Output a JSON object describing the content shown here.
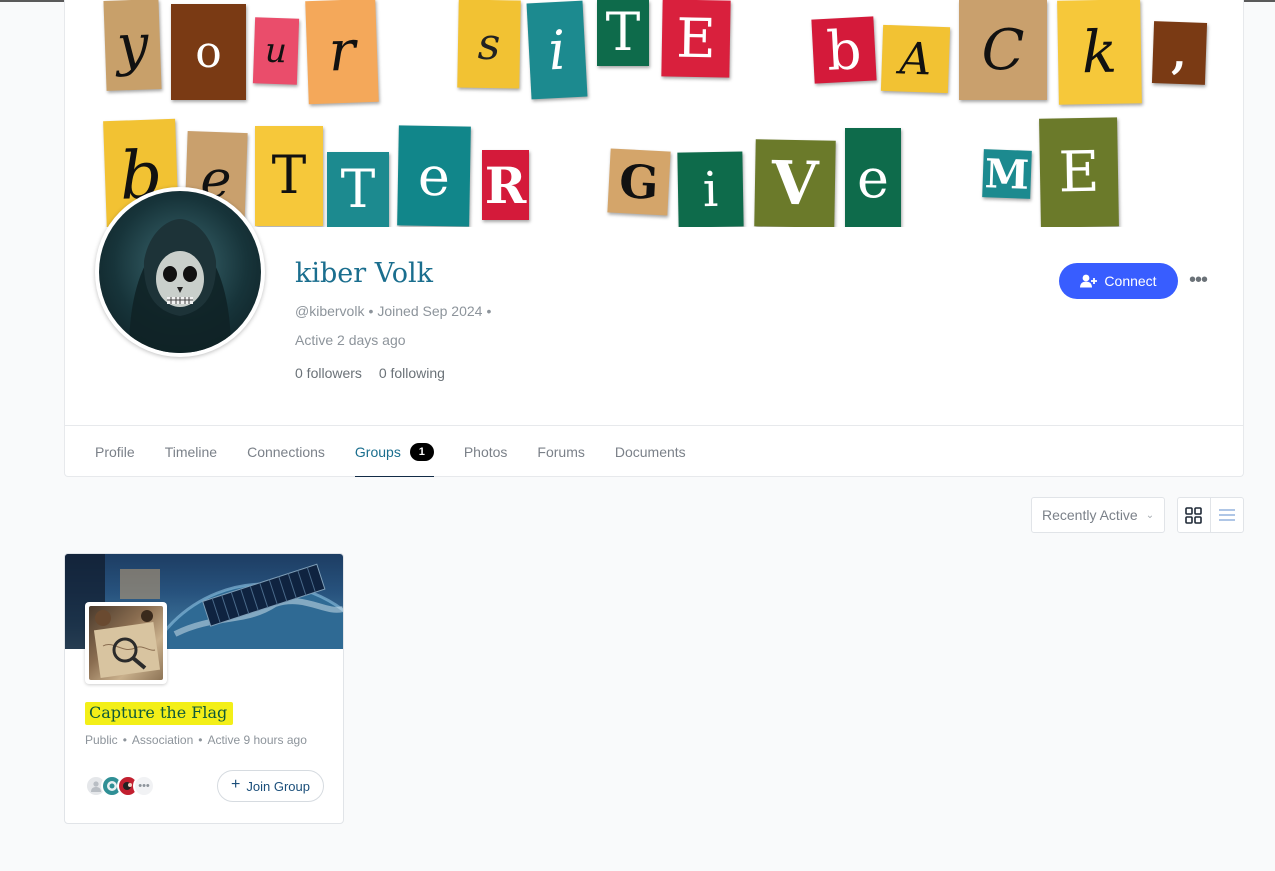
{
  "cover": {
    "letters": [
      {
        "ch": "y",
        "bg": "#c8a06a",
        "fg": "#111111"
      },
      {
        "ch": "o",
        "bg": "#7a3a14",
        "fg": "#ffffff"
      },
      {
        "ch": "u",
        "bg": "#ea4d6b",
        "fg": "#111111"
      },
      {
        "ch": "r",
        "bg": "#f4a85a",
        "fg": "#111111"
      },
      {
        "ch": "s",
        "bg": "#f2c233",
        "fg": "#222222"
      },
      {
        "ch": "i",
        "bg": "#1c8a8f",
        "fg": "#ffffff"
      },
      {
        "ch": "T",
        "bg": "#0e6b4b",
        "fg": "#ffffff"
      },
      {
        "ch": "E",
        "bg": "#d9203d",
        "fg": "#ffffff"
      },
      {
        "ch": "b",
        "bg": "#d41a3a",
        "fg": "#ffffff"
      },
      {
        "ch": "A",
        "bg": "#f2c233",
        "fg": "#111111"
      },
      {
        "ch": "C",
        "bg": "#c9a06d",
        "fg": "#111111"
      },
      {
        "ch": "k",
        "bg": "#f6c83a",
        "fg": "#111111"
      },
      {
        "ch": ",",
        "bg": "#7a3a14",
        "fg": "#ffffff"
      },
      {
        "ch": "b",
        "bg": "#f2c233",
        "fg": "#111111"
      },
      {
        "ch": "e",
        "bg": "#c9a06d",
        "fg": "#111111"
      },
      {
        "ch": "T",
        "bg": "#f6c83a",
        "fg": "#111111"
      },
      {
        "ch": "T",
        "bg": "#1c8a8f",
        "fg": "#ffffff"
      },
      {
        "ch": "e",
        "bg": "#11868a",
        "fg": "#ffffff"
      },
      {
        "ch": "R",
        "bg": "#d41a3a",
        "fg": "#ffffff"
      },
      {
        "ch": "G",
        "bg": "#d4a56a",
        "fg": "#111111"
      },
      {
        "ch": "i",
        "bg": "#0e6b4b",
        "fg": "#ffffff"
      },
      {
        "ch": "V",
        "bg": "#6b7a2a",
        "fg": "#ffffff"
      },
      {
        "ch": "e",
        "bg": "#0e6b4b",
        "fg": "#ffffff"
      },
      {
        "ch": "M",
        "bg": "#1c8a8f",
        "fg": "#ffffff"
      },
      {
        "ch": "E",
        "bg": "#6b7a2a",
        "fg": "#ffffff"
      }
    ]
  },
  "profile": {
    "name": "kiber Volk",
    "handle": "@kibervolk",
    "joined": "Joined Sep 2024",
    "active": "Active 2 days ago",
    "followers": "0 followers",
    "following": "0 following",
    "connect_label": "Connect",
    "more_label": "•••",
    "bullet": "•"
  },
  "tabs": [
    {
      "label": "Profile"
    },
    {
      "label": "Timeline"
    },
    {
      "label": "Connections"
    },
    {
      "label": "Groups",
      "count": "1",
      "active": true
    },
    {
      "label": "Photos"
    },
    {
      "label": "Forums"
    },
    {
      "label": "Documents"
    }
  ],
  "toolbar": {
    "sort_value": "Recently Active"
  },
  "group": {
    "title": "Capture the Flag",
    "visibility": "Public",
    "type": "Association",
    "activity": "Active 9 hours ago",
    "join_label": "Join Group"
  },
  "colors": {
    "accent": "#385dff",
    "name": "#1a6e8e",
    "highlight": "#f3ef18"
  }
}
